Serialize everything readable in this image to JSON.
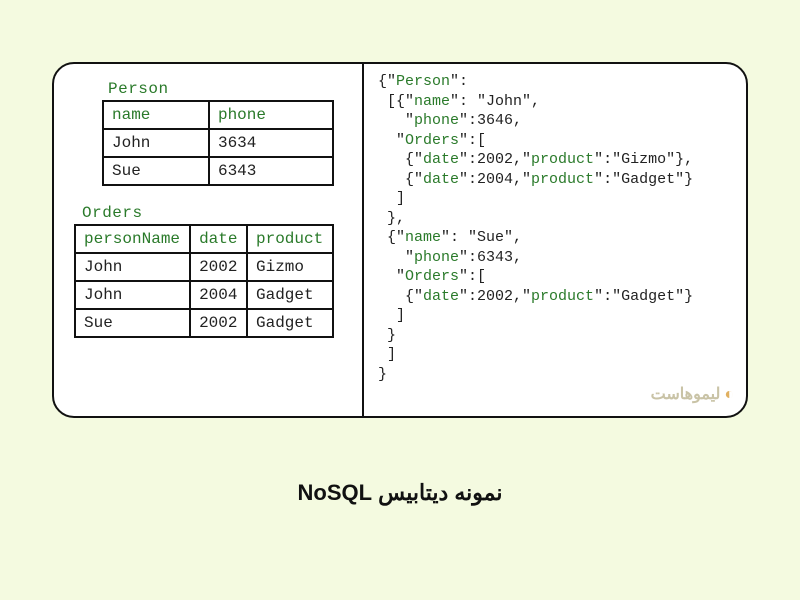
{
  "caption": "نمونه دیتابیس NoSQL",
  "watermark": "لیموهاست",
  "tables": {
    "person": {
      "title": "Person",
      "headers": [
        "name",
        "phone"
      ],
      "rows": [
        [
          "John",
          "3634"
        ],
        [
          "Sue",
          "6343"
        ]
      ]
    },
    "orders": {
      "title": "Orders",
      "headers": [
        "personName",
        "date",
        "product"
      ],
      "rows": [
        [
          "John",
          "2002",
          "Gizmo"
        ],
        [
          "John",
          "2004",
          "Gadget"
        ],
        [
          "Sue",
          "2002",
          "Gadget"
        ]
      ]
    }
  },
  "json_doc": {
    "Person": [
      {
        "name": "John",
        "phone": 3646,
        "Orders": [
          {
            "date": 2002,
            "product": "Gizmo"
          },
          {
            "date": 2004,
            "product": "Gadget"
          }
        ]
      },
      {
        "name": "Sue",
        "phone": 6343,
        "Orders": [
          {
            "date": 2002,
            "product": "Gadget"
          }
        ]
      }
    ]
  },
  "code_lines": [
    [
      [
        "p",
        "{\""
      ],
      [
        "k",
        "Person"
      ],
      [
        "p",
        "\":"
      ]
    ],
    [
      [
        "p",
        " [{\""
      ],
      [
        "k",
        "name"
      ],
      [
        "p",
        "\": \"John\","
      ]
    ],
    [
      [
        "p",
        "   \""
      ],
      [
        "k",
        "phone"
      ],
      [
        "p",
        "\":3646,"
      ]
    ],
    [
      [
        "p",
        "  \""
      ],
      [
        "k",
        "Orders"
      ],
      [
        "p",
        "\":["
      ]
    ],
    [
      [
        "p",
        "   {\""
      ],
      [
        "k",
        "date"
      ],
      [
        "p",
        "\":2002,\""
      ],
      [
        "k",
        "product"
      ],
      [
        "p",
        "\":\"Gizmo\"},"
      ]
    ],
    [
      [
        "p",
        "   {\""
      ],
      [
        "k",
        "date"
      ],
      [
        "p",
        "\":2004,\""
      ],
      [
        "k",
        "product"
      ],
      [
        "p",
        "\":\"Gadget\"}"
      ]
    ],
    [
      [
        "p",
        "  ]"
      ]
    ],
    [
      [
        "p",
        " },"
      ]
    ],
    [
      [
        "p",
        " {\""
      ],
      [
        "k",
        "name"
      ],
      [
        "p",
        "\": \"Sue\","
      ]
    ],
    [
      [
        "p",
        "   \""
      ],
      [
        "k",
        "phone"
      ],
      [
        "p",
        "\":6343,"
      ]
    ],
    [
      [
        "p",
        "  \""
      ],
      [
        "k",
        "Orders"
      ],
      [
        "p",
        "\":["
      ]
    ],
    [
      [
        "p",
        "   {\""
      ],
      [
        "k",
        "date"
      ],
      [
        "p",
        "\":2002,\""
      ],
      [
        "k",
        "product"
      ],
      [
        "p",
        "\":\"Gadget\"}"
      ]
    ],
    [
      [
        "p",
        "  ]"
      ]
    ],
    [
      [
        "p",
        " }"
      ]
    ],
    [
      [
        "p",
        " ]"
      ]
    ],
    [
      [
        "p",
        "}"
      ]
    ]
  ]
}
